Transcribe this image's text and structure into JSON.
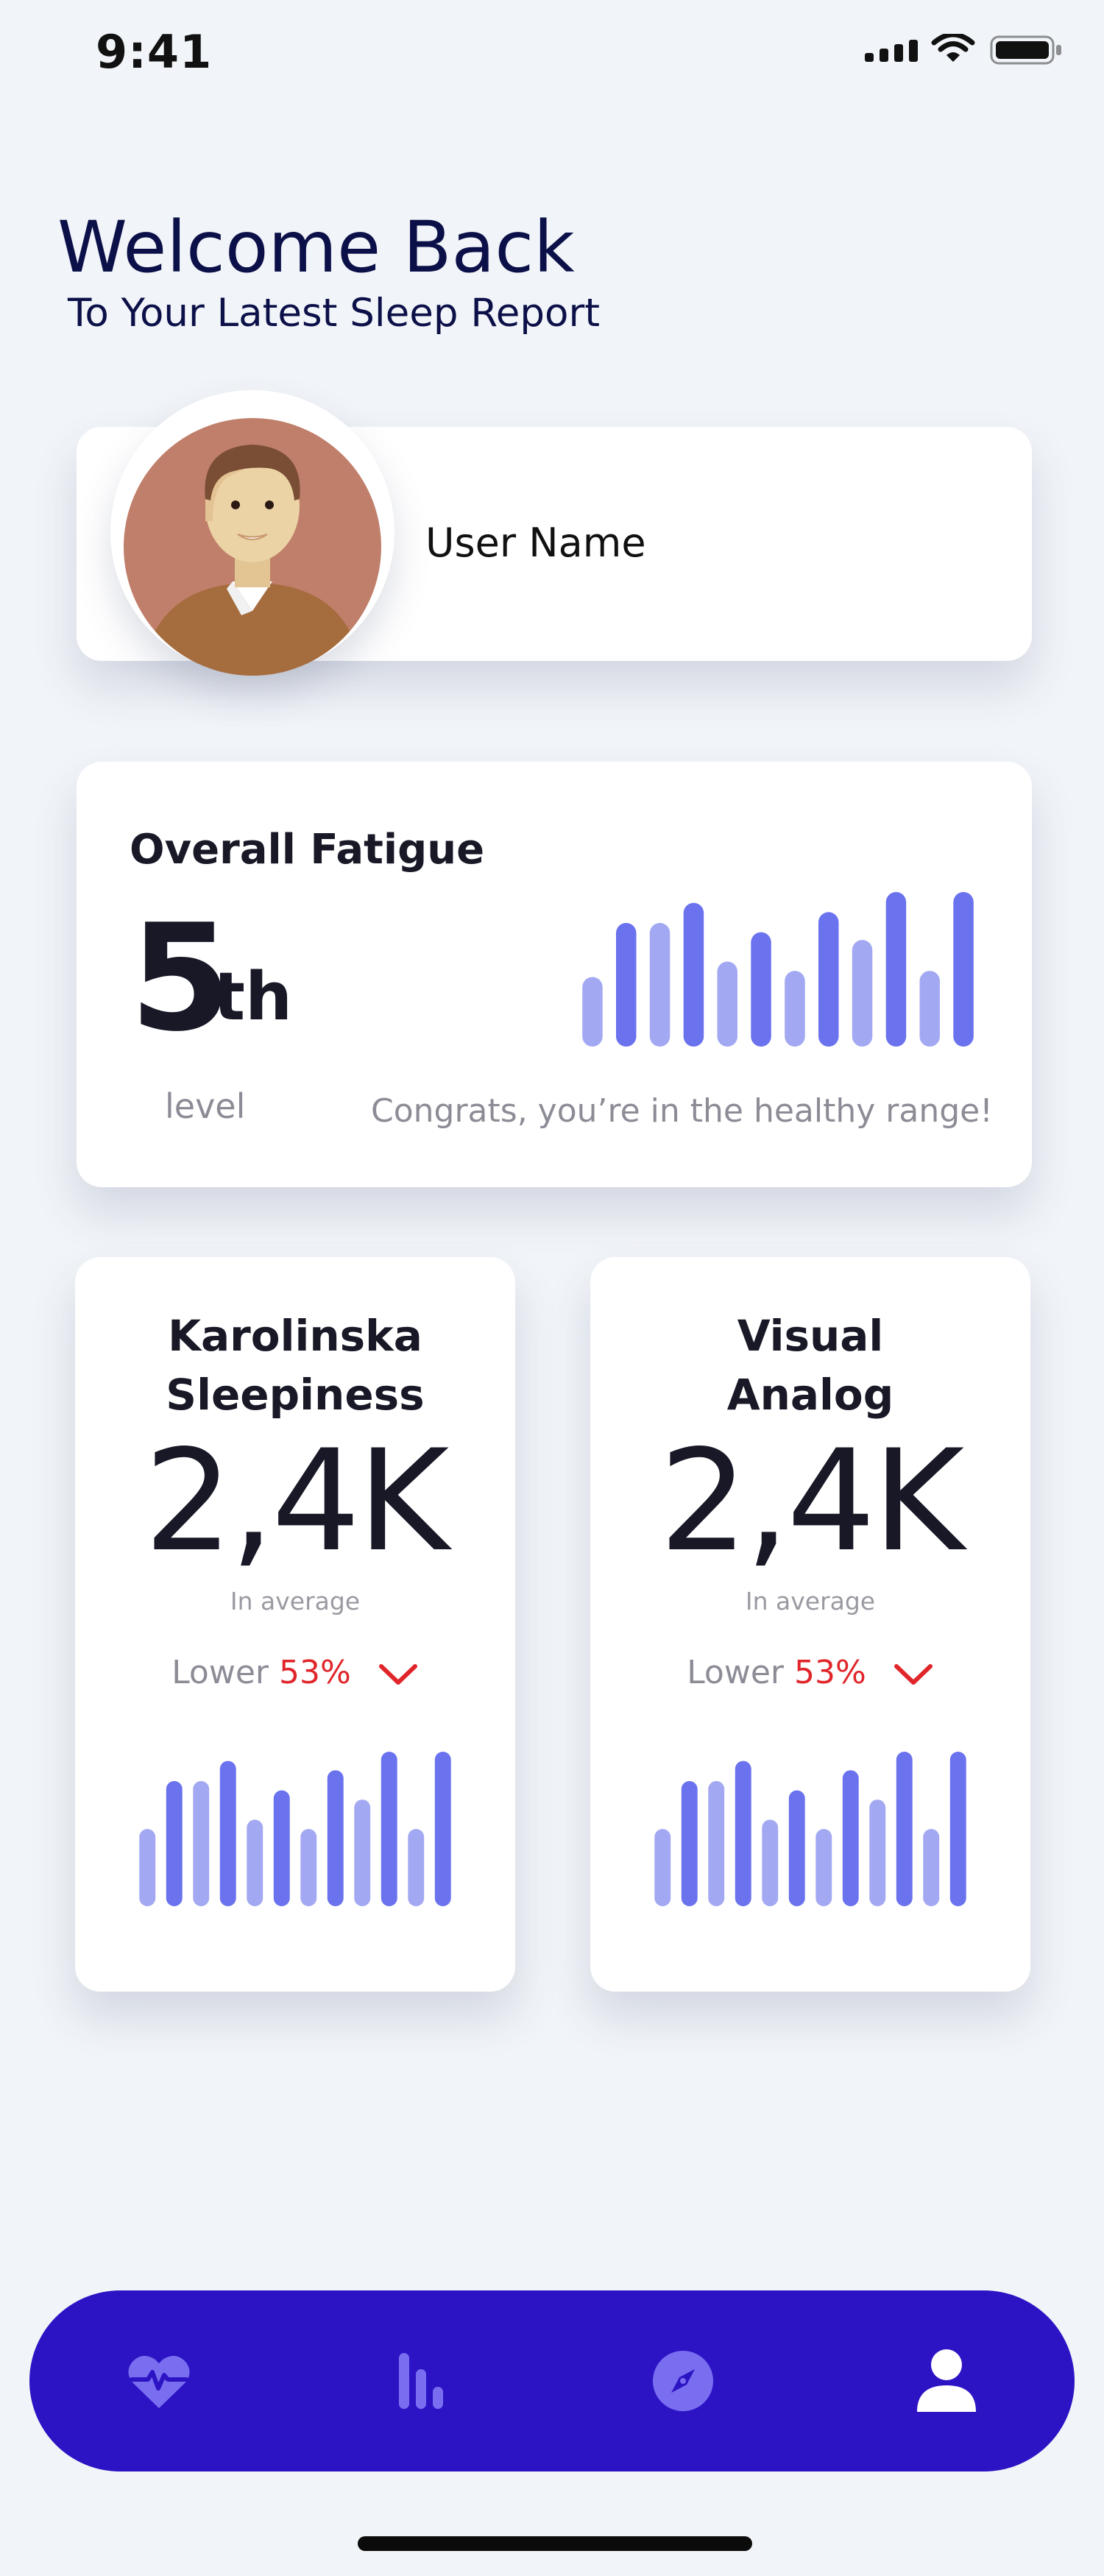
{
  "status_bar": {
    "time": "9:41"
  },
  "header": {
    "title": "Welcome Back",
    "subtitle": "To Your Latest Sleep Report"
  },
  "user": {
    "name": "User Name"
  },
  "fatigue": {
    "title": "Overall Fatigue",
    "value": "5",
    "suffix": "th",
    "unit": "level",
    "message": "Congrats, you’re in the healthy range!",
    "bars": [
      0.45,
      0.8,
      0.8,
      0.93,
      0.55,
      0.74,
      0.49,
      0.87,
      0.69,
      1.0,
      0.49,
      1.0
    ]
  },
  "stats": [
    {
      "title_line1": "Karolinska",
      "title_line2": "Sleepiness",
      "value": "2,4K",
      "caption": "In average",
      "trend_label": "Lower",
      "trend_value": "53%",
      "bars": [
        0.5,
        0.81,
        0.81,
        0.94,
        0.56,
        0.75,
        0.5,
        0.88,
        0.69,
        1.0,
        0.5,
        1.0
      ]
    },
    {
      "title_line1": "Visual",
      "title_line2": "Analog",
      "value": "2,4K",
      "caption": "In average",
      "trend_label": "Lower",
      "trend_value": "53%",
      "bars": [
        0.5,
        0.81,
        0.81,
        0.94,
        0.56,
        0.75,
        0.5,
        0.88,
        0.69,
        1.0,
        0.5,
        1.0
      ]
    }
  ],
  "colors": {
    "bar_light": "#a3a8f3",
    "bar_dark": "#6a72ee",
    "nav_background": "#2c14c4",
    "nav_icon_inactive": "#7a6ef0",
    "nav_icon_active": "#ffffff",
    "trend_down": "#e0262b",
    "title_navy": "#0c1048"
  },
  "nav": {
    "items": [
      {
        "icon": "heart-pulse-icon",
        "active": false
      },
      {
        "icon": "bar-chart-icon",
        "active": false
      },
      {
        "icon": "compass-icon",
        "active": false
      },
      {
        "icon": "user-icon",
        "active": true
      }
    ]
  }
}
